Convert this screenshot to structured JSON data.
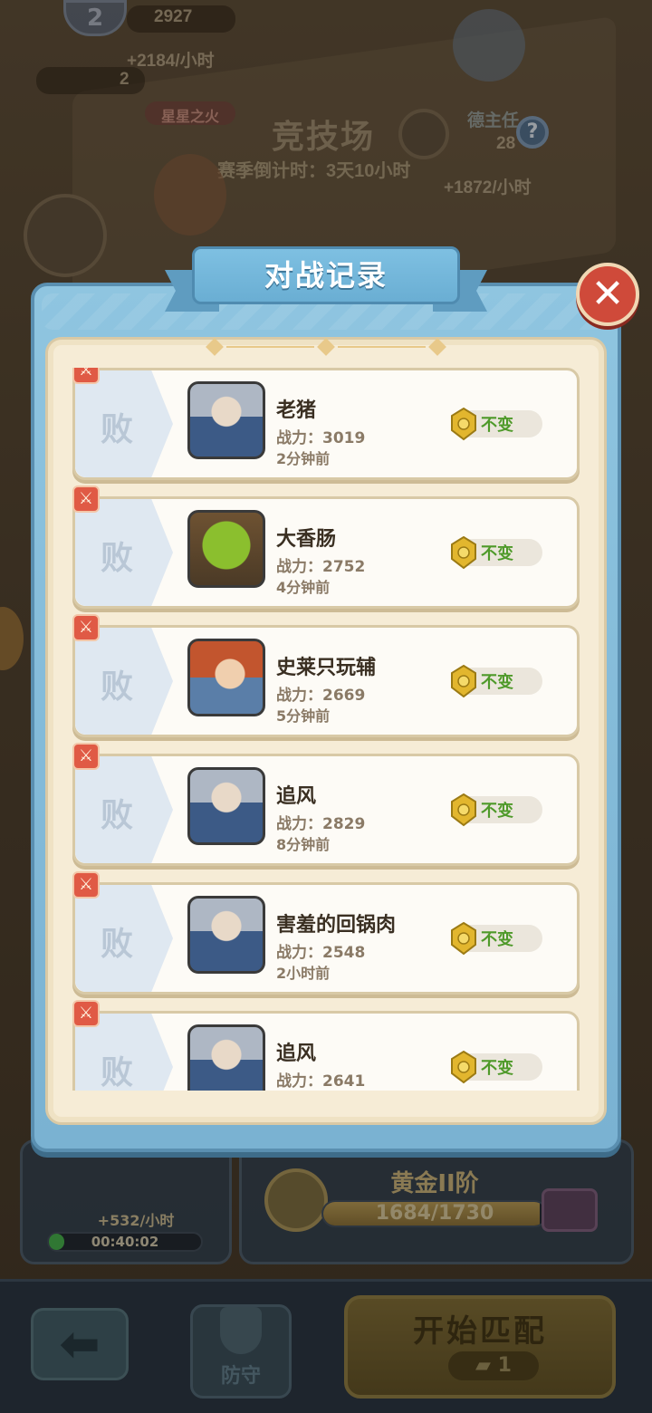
{
  "background": {
    "player_left_score": "2927",
    "player_left_income": "+2184/小时",
    "ticket_count": "2",
    "title_badge": "星星之火",
    "arena_title": "竞技场",
    "season_countdown": "赛季倒计时：3天10小时",
    "player_right_name": "德主任",
    "player_right_score": "28",
    "player_right_income": "+1872/小时",
    "help_glyph": "?"
  },
  "dialog": {
    "title": "对战记录",
    "close_glyph": "✕"
  },
  "records": [
    {
      "result": "败",
      "name": "老猪",
      "power": "战力：3019",
      "time": "2分钟前",
      "change": "不变",
      "avatar": "knight"
    },
    {
      "result": "败",
      "name": "大香肠",
      "power": "战力：2752",
      "time": "4分钟前",
      "change": "不变",
      "avatar": "orc"
    },
    {
      "result": "败",
      "name": "史莱只玩辅",
      "power": "战力：2669",
      "time": "5分钟前",
      "change": "不变",
      "avatar": "king"
    },
    {
      "result": "败",
      "name": "追风",
      "power": "战力：2829",
      "time": "8分钟前",
      "change": "不变",
      "avatar": "knight"
    },
    {
      "result": "败",
      "name": "害羞的回锅肉",
      "power": "战力：2548",
      "time": "2小时前",
      "change": "不变",
      "avatar": "knight"
    },
    {
      "result": "败",
      "name": "追风",
      "power": "战力：2641",
      "time": "",
      "change": "不变",
      "avatar": "knight"
    }
  ],
  "bottom": {
    "income": "+532/小时",
    "timer": "00:40:02",
    "timer_progress": 0.1,
    "rank_name": "黄金II阶",
    "rank_progress": "1684/1730",
    "rank_fraction": 0.973,
    "back_glyph": "⬅",
    "defend_label": "防守",
    "match_label": "开始匹配",
    "match_cost": "1"
  },
  "colors": {
    "modal_blue": "#7ab2d2",
    "lose_red": "#e05a45",
    "unchanged_green": "#4f9a2a"
  }
}
